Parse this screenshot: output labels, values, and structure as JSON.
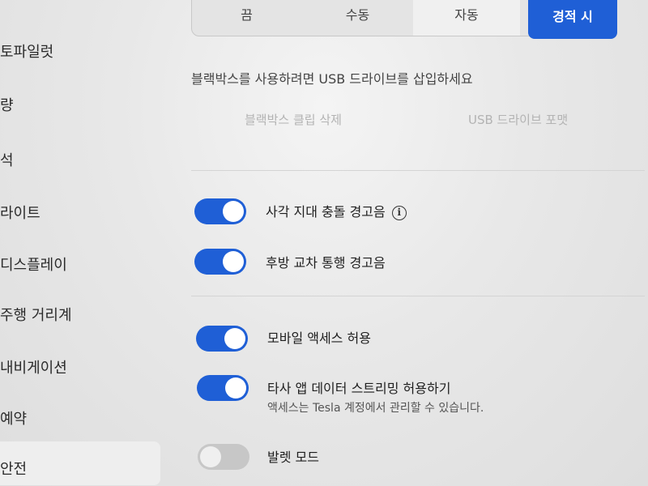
{
  "sidebar": {
    "items": [
      {
        "label": "토파일럿"
      },
      {
        "label": "량"
      },
      {
        "label": "석"
      },
      {
        "label": "라이트"
      },
      {
        "label": "디스플레이"
      },
      {
        "label": "주행 거리계"
      },
      {
        "label": "내비게이션"
      },
      {
        "label": "예약"
      },
      {
        "label": "안전",
        "selected": true
      }
    ]
  },
  "dashcam": {
    "options": [
      "끔",
      "수동",
      "자동",
      "경적 시"
    ],
    "selected": "자동",
    "note": "블랙박스를 사용하려면 USB 드라이브를 삽입하세요",
    "delete_clips": "블랙박스 클립 삭제",
    "format_usb": "USB 드라이브 포맷"
  },
  "settings": {
    "blind_spot": {
      "label": "사각 지대 충돌 경고음",
      "on": true,
      "icon": "info-icon"
    },
    "rear_cross": {
      "label": "후방 교차 통행 경고음",
      "on": true
    },
    "mobile_access": {
      "label": "모바일 액세스 허용",
      "on": true
    },
    "third_party": {
      "label": "타사 앱 데이터 스트리밍 허용하기",
      "on": true,
      "sublabel": "액세스는 Tesla 계정에서 관리할 수 있습니다."
    },
    "valet": {
      "label": "발렛 모드",
      "on": false
    }
  },
  "colors": {
    "accent": "#1f5fd6",
    "toggle_off": "#c7c7c7"
  }
}
